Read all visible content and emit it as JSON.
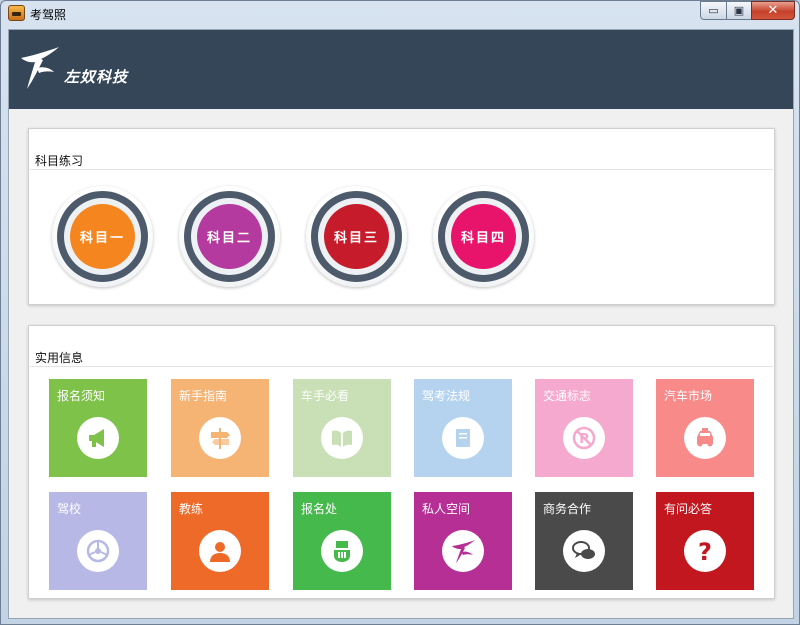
{
  "window": {
    "title": "考驾照",
    "minimize_glyph": "▭",
    "maximize_glyph": "▣",
    "close_glyph": "✕"
  },
  "header": {
    "company_name": "左奴科技",
    "background": "#354659"
  },
  "subjects_panel": {
    "title": "科目练习",
    "items": [
      {
        "label": "科目一",
        "color": "#f5861f"
      },
      {
        "label": "科目二",
        "color": "#b53aa0"
      },
      {
        "label": "科目三",
        "color": "#c61b2b"
      },
      {
        "label": "科目四",
        "color": "#e8136a"
      }
    ]
  },
  "info_panel": {
    "title": "实用信息",
    "tiles": [
      {
        "label": "报名须知",
        "color": "#7ec24a",
        "icon": "megaphone-icon"
      },
      {
        "label": "新手指南",
        "color": "#f5b374",
        "icon": "signpost-icon"
      },
      {
        "label": "车手必看",
        "color": "#c9dfb5",
        "icon": "book-icon"
      },
      {
        "label": "驾考法规",
        "color": "#b5d3ef",
        "icon": "document-icon"
      },
      {
        "label": "交通标志",
        "color": "#f6a9cf",
        "icon": "no-parking-icon"
      },
      {
        "label": "汽车市场",
        "color": "#f88a8a",
        "icon": "car-icon"
      },
      {
        "label": "驾校",
        "color": "#b7b8e6",
        "icon": "steering-wheel-icon"
      },
      {
        "label": "教练",
        "color": "#ee6a28",
        "icon": "person-icon"
      },
      {
        "label": "报名处",
        "color": "#46b94d",
        "icon": "hand-register-icon"
      },
      {
        "label": "私人空间",
        "color": "#b52f94",
        "icon": "logo-mark-icon"
      },
      {
        "label": "商务合作",
        "color": "#4a4a4a",
        "icon": "chat-bubbles-icon"
      },
      {
        "label": "有问必答",
        "color": "#c2171f",
        "icon": "question-icon"
      }
    ]
  }
}
